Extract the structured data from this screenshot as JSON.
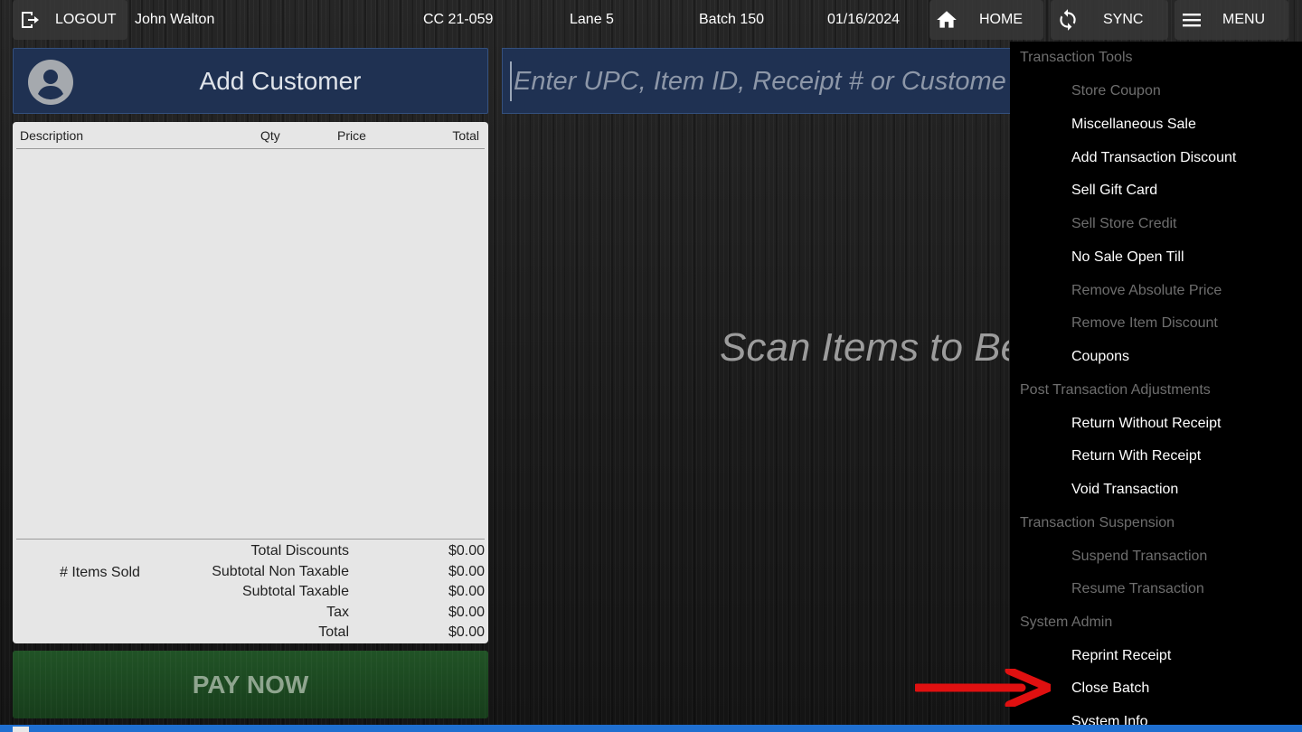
{
  "topbar": {
    "logout_label": "LOGOUT",
    "user_name": "John Walton",
    "store_code": "CC 21-059",
    "lane": "Lane 5",
    "batch": "Batch 150",
    "date": "01/16/2024",
    "home_label": "HOME",
    "sync_label": "SYNC",
    "menu_label": "MENU"
  },
  "customer": {
    "add_label": "Add Customer"
  },
  "search": {
    "placeholder": "Enter UPC, Item ID, Receipt # or Customer ID",
    "value": ""
  },
  "receipt": {
    "columns": {
      "description": "Description",
      "qty": "Qty",
      "price": "Price",
      "total": "Total"
    },
    "items_sold_label": "# Items Sold",
    "summary": [
      {
        "label": "Total Discounts",
        "value": "$0.00"
      },
      {
        "label": "Subtotal Non Taxable",
        "value": "$0.00"
      },
      {
        "label": "Subtotal Taxable",
        "value": "$0.00"
      },
      {
        "label": "Tax",
        "value": "$0.00"
      },
      {
        "label": "Total",
        "value": "$0.00"
      }
    ]
  },
  "pay_now_label": "PAY NOW",
  "scan_message": "Scan Items to Begin",
  "menu": {
    "sections": [
      {
        "title": "Transaction Tools",
        "items": [
          {
            "label": "Store Coupon",
            "enabled": false
          },
          {
            "label": "Miscellaneous Sale",
            "enabled": true
          },
          {
            "label": "Add Transaction Discount",
            "enabled": true
          },
          {
            "label": "Sell Gift Card",
            "enabled": true
          },
          {
            "label": "Sell Store Credit",
            "enabled": false
          },
          {
            "label": "No Sale Open Till",
            "enabled": true
          },
          {
            "label": "Remove Absolute Price",
            "enabled": false
          },
          {
            "label": "Remove Item Discount",
            "enabled": false
          },
          {
            "label": "Coupons",
            "enabled": true
          }
        ]
      },
      {
        "title": "Post Transaction Adjustments",
        "items": [
          {
            "label": "Return Without Receipt",
            "enabled": true
          },
          {
            "label": "Return With Receipt",
            "enabled": true
          },
          {
            "label": "Void Transaction",
            "enabled": true
          }
        ]
      },
      {
        "title": "Transaction Suspension",
        "items": [
          {
            "label": "Suspend Transaction",
            "enabled": false
          },
          {
            "label": "Resume Transaction",
            "enabled": false
          }
        ]
      },
      {
        "title": "System Admin",
        "items": [
          {
            "label": "Reprint Receipt",
            "enabled": true
          },
          {
            "label": "Close Batch",
            "enabled": true
          },
          {
            "label": "System Info",
            "enabled": true
          }
        ]
      }
    ]
  },
  "colors": {
    "accent_blue": "#1f3152",
    "pay_green": "#1e4a22",
    "annotation_arrow": "#e01010",
    "disabled_text": "#6e6e6e"
  }
}
